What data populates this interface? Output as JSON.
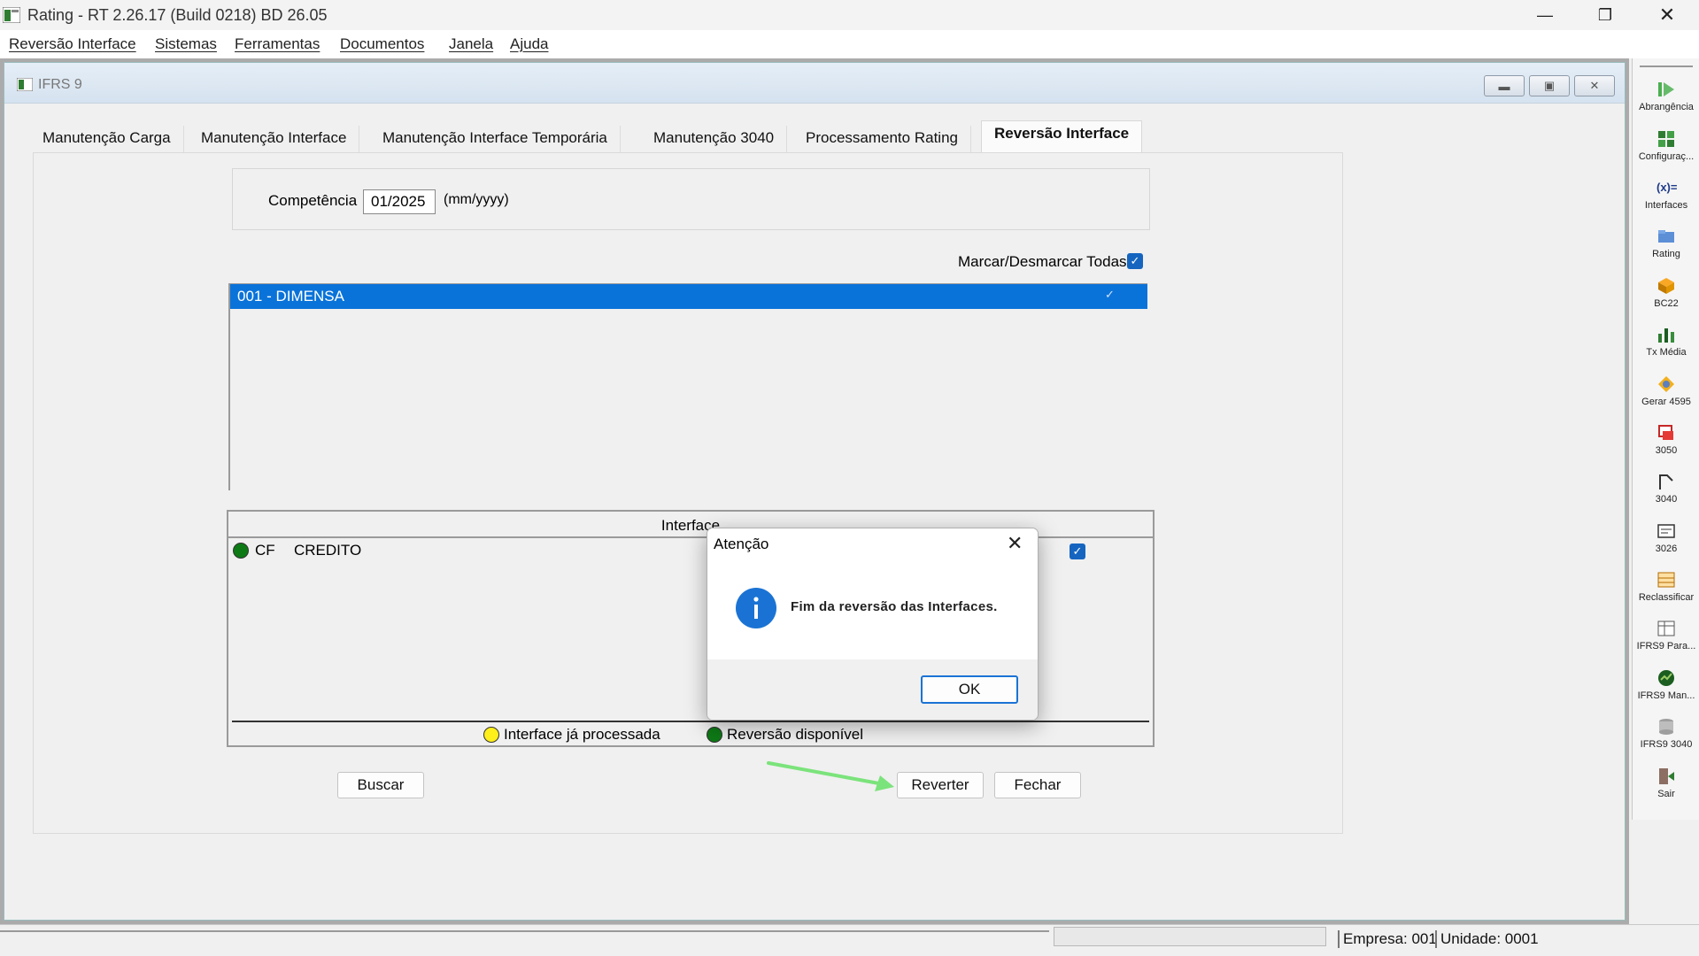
{
  "window": {
    "title": "Rating - RT 2.26.17 (Build 0218) BD 26.05"
  },
  "menu": [
    "Reversão Interface",
    "Sistemas",
    "Ferramentas",
    "Documentos",
    "Janela",
    "Ajuda"
  ],
  "child_window": {
    "title": "IFRS 9"
  },
  "tabs": [
    "Manutenção Carga",
    "Manutenção Interface",
    "Manutenção Interface Temporária",
    "Manutenção 3040",
    "Processamento Rating",
    "Reversão Interface"
  ],
  "active_tab": "Reversão Interface",
  "form": {
    "competencia_label": "Competência",
    "competencia_value": "01/2025",
    "competencia_hint": "(mm/yyyy)",
    "toggle_all_label": "Marcar/Desmarcar Todas"
  },
  "company_list": [
    {
      "label": "001 - DIMENSA",
      "checked": true,
      "selected": true
    }
  ],
  "interfaces": {
    "header": "Interface",
    "rows": [
      {
        "code": "CF",
        "name": "CREDITO",
        "status_color": "#0e7a16",
        "checked": true
      }
    ],
    "legend": [
      {
        "label": "Interface já processada",
        "color": "#ffef1a"
      },
      {
        "label": "Reversão disponível",
        "color": "#0e7a16"
      }
    ]
  },
  "buttons": {
    "buscar": "Buscar",
    "reverter": "Reverter",
    "fechar": "Fechar"
  },
  "dialog": {
    "title": "Atenção",
    "message": "Fim da reversão das Interfaces.",
    "ok": "OK",
    "icon": "info-icon"
  },
  "toolbar": [
    {
      "label": "Abrangência",
      "icon": "play-icon"
    },
    {
      "label": "Configuraç...",
      "icon": "grid-config-icon"
    },
    {
      "label": "Interfaces",
      "icon": "function-icon"
    },
    {
      "label": "Rating",
      "icon": "folder-open-icon"
    },
    {
      "label": "BC22",
      "icon": "box-icon"
    },
    {
      "label": "Tx Média",
      "icon": "chart-icon"
    },
    {
      "label": "Gerar 4595",
      "icon": "diamond-icon"
    },
    {
      "label": "3050",
      "icon": "database-red-icon"
    },
    {
      "label": "3040",
      "icon": "flow-icon"
    },
    {
      "label": "3026",
      "icon": "form-icon"
    },
    {
      "label": "Reclassificar",
      "icon": "table-edit-icon"
    },
    {
      "label": "IFRS9 Para...",
      "icon": "table-icon"
    },
    {
      "label": "IFRS9 Man...",
      "icon": "globe-icon"
    },
    {
      "label": "IFRS9 3040",
      "icon": "database-icon"
    },
    {
      "label": "Sair",
      "icon": "exit-door-icon"
    }
  ],
  "status": {
    "empresa": "Empresa: 001",
    "unidade": "Unidade: 0001"
  },
  "colors": {
    "selection": "#0a73d9",
    "checkbox": "#1565c0",
    "info": "#1a73d4",
    "arrow": "#7be37b"
  }
}
